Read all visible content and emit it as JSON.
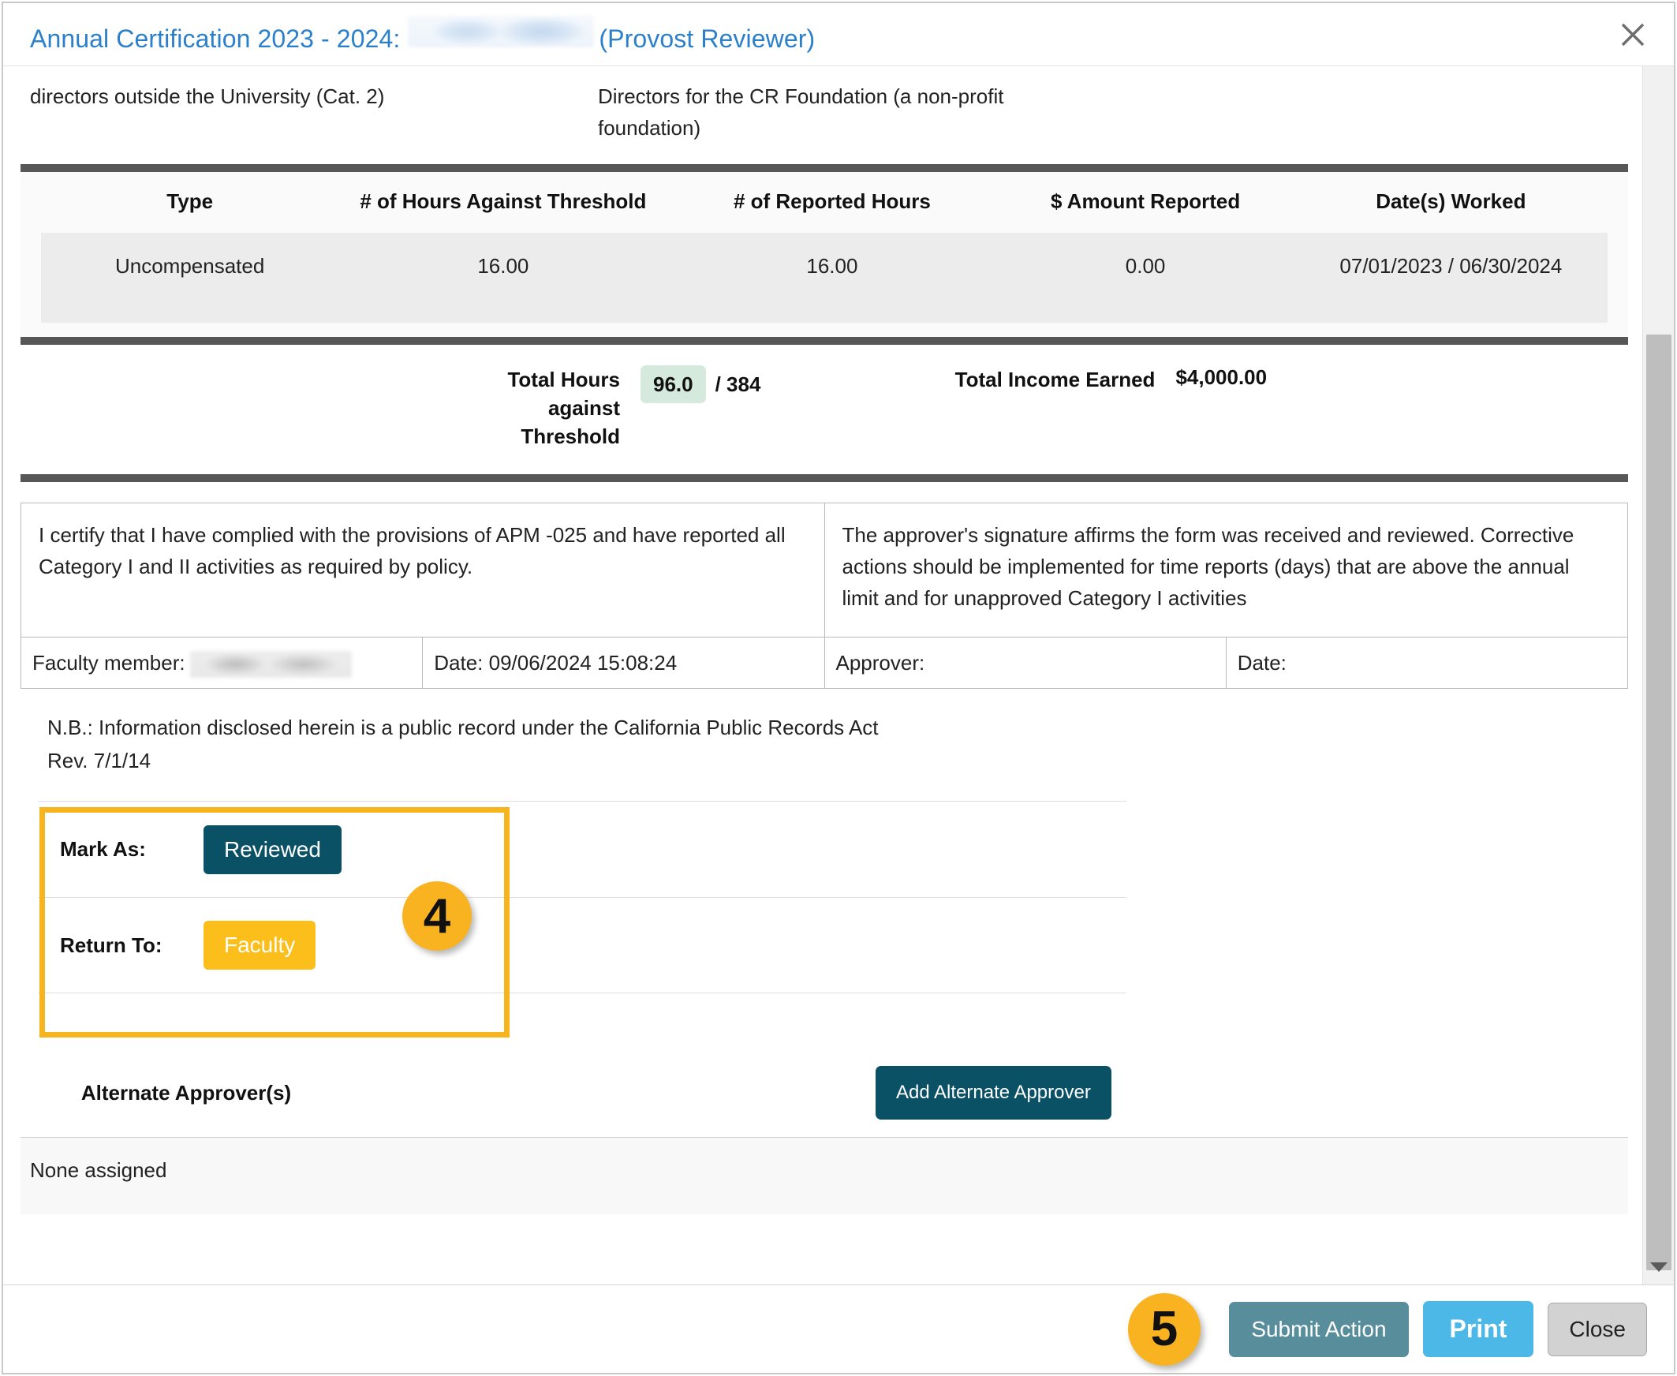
{
  "modal": {
    "title_prefix": "Annual Certification 2023 - 2024:",
    "title_role": "(Provost Reviewer)",
    "close_icon": "close-icon"
  },
  "description": {
    "left": "directors outside the University (Cat. 2)",
    "right": "Directors for the CR Foundation (a non-profit foundation)"
  },
  "detail_table": {
    "headers": [
      "Type",
      "# of Hours Against Threshold",
      "# of Reported Hours",
      "$ Amount Reported",
      "Date(s) Worked"
    ],
    "rows": [
      {
        "type": "Uncompensated",
        "hours_against_threshold": "16.00",
        "reported_hours": "16.00",
        "amount_reported": "0.00",
        "dates_worked": "07/01/2023 / 06/30/2024"
      }
    ]
  },
  "totals": {
    "hours_label": "Total Hours against Threshold",
    "hours_value": "96.0",
    "hours_denominator": "/ 384",
    "income_label": "Total Income Earned",
    "income_value": "$4,000.00",
    "hours_chip_color": "#d5e9dd"
  },
  "certification": {
    "faculty_statement": "I certify that I have complied with the provisions of APM -025 and have reported all Category I and II activities as required by policy.",
    "approver_statement": "The approver's signature affirms the form was received and reviewed. Corrective actions should be implemented for time reports (days) that are above the annual limit and for unapproved Category I activities",
    "faculty_member_label": "Faculty member:",
    "faculty_date": "Date: 09/06/2024 15:08:24",
    "approver_label": "Approver:",
    "approver_date": "Date:"
  },
  "note": {
    "line1": "N.B.: Information disclosed herein is a public record under the California Public Records Act",
    "line2": "Rev. 7/1/14"
  },
  "actions": {
    "mark_as_label": "Mark As:",
    "mark_as_button": "Reviewed",
    "return_to_label": "Return To:",
    "return_to_button": "Faculty",
    "step_badge": "4",
    "highlight_color": "#f6b41e",
    "reviewed_color": "#0b5166",
    "faculty_color": "#fcbe1b"
  },
  "alternate_approvers": {
    "title": "Alternate Approver(s)",
    "add_button": "Add Alternate Approver",
    "empty_text": "None assigned"
  },
  "footer": {
    "step_badge": "5",
    "submit_label": "Submit Action",
    "print_label": "Print",
    "close_label": "Close",
    "submit_color": "#588e9c",
    "print_color": "#4cb8e8",
    "close_color": "#d2d2d2"
  }
}
